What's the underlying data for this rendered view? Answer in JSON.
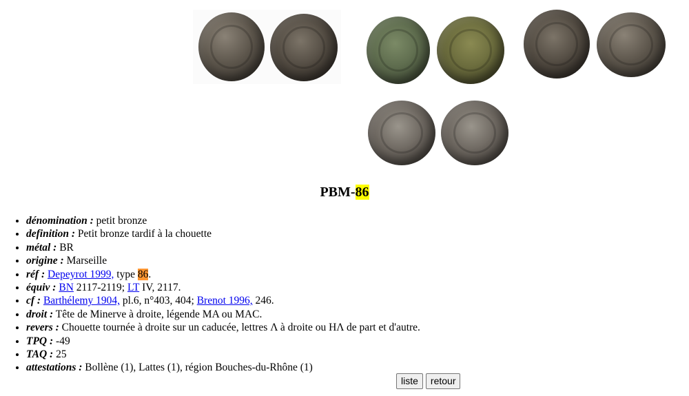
{
  "images": [
    {
      "icon": "coin-photo-obverse-reverse"
    },
    {
      "icon": "coin-photo-obverse-reverse"
    },
    {
      "icon": "coin-photo-obverse-reverse"
    },
    {
      "icon": "coin-photo-obverse-reverse"
    }
  ],
  "title": {
    "prefix": "PBM-",
    "number": "86"
  },
  "fields": {
    "denomination": {
      "label": "dénomination :",
      "value": " petit bronze"
    },
    "definition": {
      "label": "definition :",
      "value": " Petit bronze tardif à la chouette"
    },
    "metal": {
      "label": "métal :",
      "value": " BR"
    },
    "origine": {
      "label": "origine :",
      "value": " Marseille"
    },
    "ref": {
      "label": "réf :",
      "link": "Depeyrot 1999,",
      "text": " type ",
      "type_number": "86",
      "end": "."
    },
    "equiv": {
      "label": "équiv :",
      "link1": "BN",
      "text1": " 2117-2119; ",
      "link2": "LT",
      "text2": " IV, 2117."
    },
    "cf": {
      "label": "cf :",
      "link1": "Barthélemy 1904,",
      "text1": " pl.6, n°403, 404; ",
      "link2": "Brenot 1996,",
      "text2": " 246."
    },
    "droit": {
      "label": "droit :",
      "value": " Tête de Minerve à droite, légende MA ou MAC."
    },
    "revers": {
      "label": "revers :",
      "value": " Chouette tournée à droite sur un caducée, lettres Λ à droite ou HΛ de part et d'autre."
    },
    "tpq": {
      "label": "TPQ :",
      "value": " -49"
    },
    "taq": {
      "label": "TAQ :",
      "value": " 25"
    },
    "attestations": {
      "label": "attestations :",
      "value": " Bollène (1), Lattes (1), région Bouches-du-Rhône (1)"
    }
  },
  "buttons": {
    "liste": "liste",
    "retour": "retour"
  },
  "colors": {
    "highlight_yellow": "#ffff00",
    "highlight_orange": "#ff9632",
    "link": "#0000ee"
  }
}
